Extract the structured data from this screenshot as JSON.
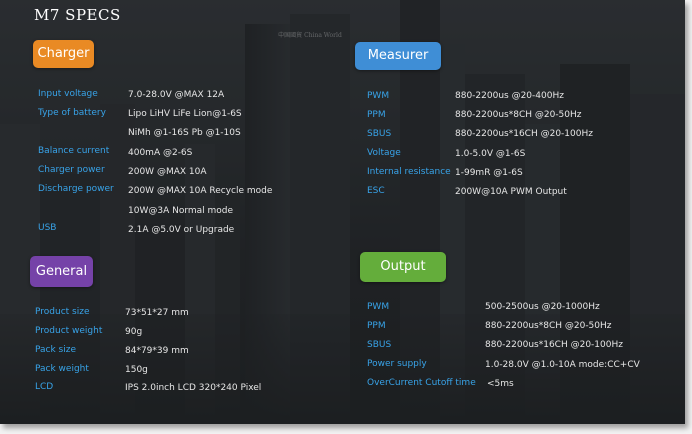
{
  "title": "M7 SPECS",
  "sections": {
    "charger": "Charger",
    "measurer": "Measurer",
    "general": "General",
    "output": "Output"
  },
  "background_sign": "中国國貿 China World",
  "charger": [
    {
      "label": "Input voltage",
      "value": "7.0-28.0V  @MAX 12A"
    },
    {
      "label": "Type of battery",
      "value": "Lipo  LiHV  LiFe Lion@1-6S"
    },
    {
      "label": "",
      "value": "NiMh @1-16S   Pb @1-10S"
    },
    {
      "label": "Balance current",
      "value": "400mA @2-6S"
    },
    {
      "label": "Charger power",
      "value": "200W @MAX 10A"
    },
    {
      "label": "Discharge power",
      "value": "200W  @MAX 10A Recycle mode"
    },
    {
      "label": "",
      "value": "10W@3A Normal mode"
    },
    {
      "label": "USB",
      "value": "2.1A @5.0V or Upgrade"
    }
  ],
  "general": [
    {
      "label": "Product size",
      "value": "73*51*27 mm"
    },
    {
      "label": "Product weight",
      "value": "90g"
    },
    {
      "label": "Pack size",
      "value": "84*79*39 mm"
    },
    {
      "label": "Pack weight",
      "value": "150g"
    },
    {
      "label": "LCD",
      "value": "IPS  2.0inch LCD 320*240 Pixel"
    }
  ],
  "measurer": [
    {
      "label": "PWM",
      "value": "880-2200us @20-400Hz"
    },
    {
      "label": "PPM",
      "value": "880-2200us*8CH @20-50Hz"
    },
    {
      "label": "SBUS",
      "value": "880-2200us*16CH @20-100Hz"
    },
    {
      "label": "Voltage",
      "value": "1.0-5.0V @1-6S"
    },
    {
      "label": "Internal resistance",
      "value": "1-99mR @1-6S"
    },
    {
      "label": "ESC",
      "value": "200W@10A      PWM Output"
    }
  ],
  "output": [
    {
      "label": "PWM",
      "value": "500-2500us @20-1000Hz"
    },
    {
      "label": "PPM",
      "value": "880-2200us*8CH @20-50Hz"
    },
    {
      "label": "SBUS",
      "value": "880-2200us*16CH @20-100Hz"
    },
    {
      "label": "Power supply",
      "value": "1.0-28.0V  @1.0-10A  mode:CC+CV"
    },
    {
      "label": "OverCurrent Cutoff time",
      "value": "<5ms"
    }
  ]
}
